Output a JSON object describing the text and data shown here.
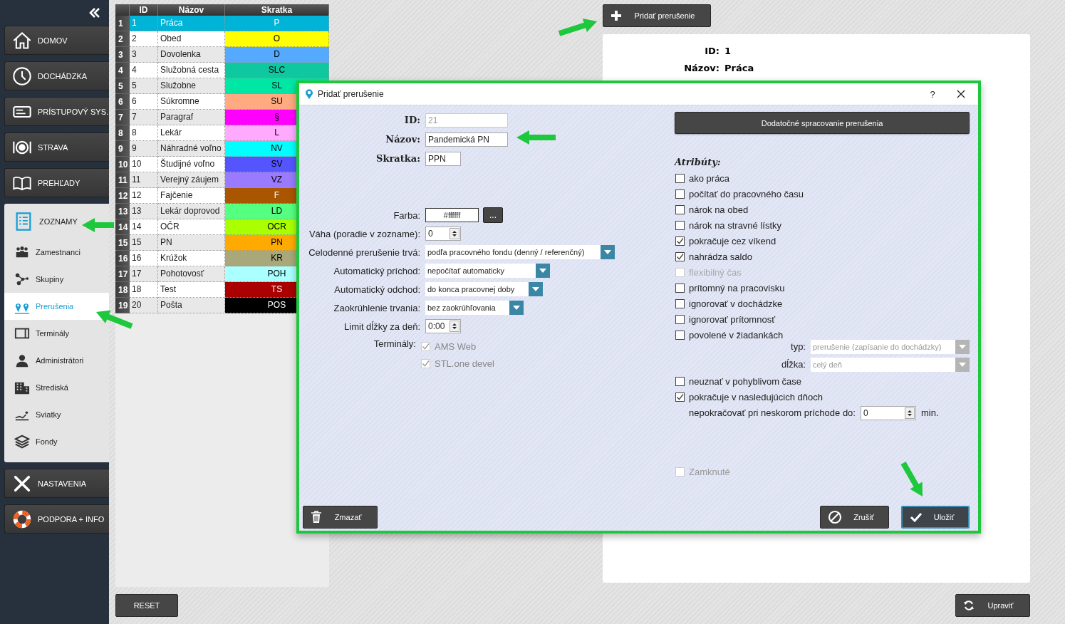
{
  "sidebar": {
    "items": [
      {
        "label": "DOMOV",
        "expanded": false
      },
      {
        "label": "DOCHÁDZKA",
        "expanded": false
      },
      {
        "label": "PRÍSTUPOVÝ SYS.",
        "expanded": false
      },
      {
        "label": "STRAVA",
        "expanded": false
      },
      {
        "label": "PREHĽADY",
        "expanded": false
      },
      {
        "label": "ZOZNAMY",
        "expanded": true,
        "children": [
          {
            "label": "Zamestnanci",
            "selected": false
          },
          {
            "label": "Skupiny",
            "selected": false
          },
          {
            "label": "Prerušenia",
            "selected": true
          },
          {
            "label": "Terminály",
            "selected": false
          },
          {
            "label": "Administrátori",
            "selected": false
          },
          {
            "label": "Strediská",
            "selected": false
          },
          {
            "label": "Sviatky",
            "selected": false
          },
          {
            "label": "Fondy",
            "selected": false
          }
        ]
      },
      {
        "label": "NASTAVENIA",
        "expanded": false
      },
      {
        "label": "PODPORA + INFO",
        "expanded": false
      }
    ]
  },
  "table": {
    "columns": [
      "ID",
      "Názov",
      "Skratka"
    ],
    "rows": [
      {
        "number": "1",
        "id": "1",
        "name": "Práca",
        "code": "P",
        "color": "#00b4d8",
        "selected": true
      },
      {
        "number": "2",
        "id": "2",
        "name": "Obed",
        "code": "O",
        "color": "#ffff00",
        "selected": false
      },
      {
        "number": "3",
        "id": "3",
        "name": "Dovolenka",
        "code": "D",
        "color": "#55aaff",
        "selected": false
      },
      {
        "number": "4",
        "id": "4",
        "name": "Služobná cesta",
        "code": "SLC",
        "color": "#10c8a0",
        "selected": false
      },
      {
        "number": "5",
        "id": "5",
        "name": "Služobne",
        "code": "SL",
        "color": "#00e6a5",
        "selected": false
      },
      {
        "number": "6",
        "id": "6",
        "name": "Súkromne",
        "code": "SU",
        "color": "#ffaa80",
        "selected": false
      },
      {
        "number": "7",
        "id": "7",
        "name": "Paragraf",
        "code": "§",
        "color": "#ff00ff",
        "selected": false
      },
      {
        "number": "8",
        "id": "8",
        "name": "Lekár",
        "code": "L",
        "color": "#ffaaff",
        "selected": false
      },
      {
        "number": "9",
        "id": "9",
        "name": "Náhradné voľno",
        "code": "NV",
        "color": "#00ffff",
        "selected": false
      },
      {
        "number": "10",
        "id": "10",
        "name": "Študijné voľno",
        "code": "SV",
        "color": "#5555ff",
        "selected": false
      },
      {
        "number": "11",
        "id": "11",
        "name": "Verejný záujem",
        "code": "VZ",
        "color": "#9a7aff",
        "selected": false
      },
      {
        "number": "12",
        "id": "12",
        "name": "Fajčenie",
        "code": "F",
        "color": "#aa5500",
        "selected": false
      },
      {
        "number": "13",
        "id": "13",
        "name": "Lekár doprovod",
        "code": "LD",
        "color": "#55ff80",
        "selected": false
      },
      {
        "number": "14",
        "id": "14",
        "name": "OČR",
        "code": "OCR",
        "color": "#aaff00",
        "selected": false
      },
      {
        "number": "15",
        "id": "15",
        "name": "PN",
        "code": "PN",
        "color": "#ffaa00",
        "selected": false
      },
      {
        "number": "16",
        "id": "16",
        "name": "Krúžok",
        "code": "KR",
        "color": "#a8a87a",
        "selected": false
      },
      {
        "number": "17",
        "id": "17",
        "name": "Pohotovosť",
        "code": "POH",
        "color": "#aaffff",
        "selected": false
      },
      {
        "number": "18",
        "id": "18",
        "name": "Test",
        "code": "TS",
        "color": "#aa0000",
        "selected": false
      },
      {
        "number": "19",
        "id": "20",
        "name": "Pošta",
        "code": "POS",
        "color": "#000000",
        "selected": false
      }
    ]
  },
  "reset_button": "RESET",
  "add_button": "Pridať prerušenie",
  "detail": {
    "fields": [
      {
        "label": "ID:",
        "value": "1"
      },
      {
        "label": "Názov:",
        "value": "Práca"
      }
    ]
  },
  "edit_button": "Upraviť",
  "dialog": {
    "title": "Pridať prerušenie",
    "help": "?",
    "fields": [
      {
        "kind": "text",
        "label": "ID:",
        "value": "21",
        "disabled": true
      },
      {
        "kind": "text",
        "label": "Názov:",
        "value": "Pandemická PN",
        "disabled": false
      },
      {
        "kind": "text",
        "label": "Skratka:",
        "value": "PPN",
        "disabled": false
      },
      {
        "kind": "color",
        "label": "Farba:",
        "value": "#ffffff",
        "button": "..."
      },
      {
        "kind": "spin",
        "label": "Váha (poradie v zozname):",
        "value": "0"
      },
      {
        "kind": "select",
        "label": "Celodenné prerušenie trvá:",
        "value": "podľa pracovného fondu (denný / referenčný)"
      },
      {
        "kind": "select",
        "label": "Automatický príchod:",
        "value": "nepočítať automaticky"
      },
      {
        "kind": "select",
        "label": "Automatický odchod:",
        "value": "do konca pracovnej doby"
      },
      {
        "kind": "select",
        "label": "Zaokrúhlenie trvania:",
        "value": "bez zaokrúhľovania"
      },
      {
        "kind": "spin",
        "label": "Limit dĺžky za deň:",
        "value": "0:00"
      },
      {
        "kind": "checks",
        "label": "Terminály:",
        "options": [
          {
            "label": "AMS Web",
            "checked": true,
            "disabled": true
          },
          {
            "label": "STL.one devel",
            "checked": true,
            "disabled": true
          }
        ]
      }
    ],
    "extra_button": "Dodatočné spracovanie prerušenia",
    "attributes_title": "Atribúty:",
    "attributes": [
      {
        "kind": "check",
        "label": "ako práca",
        "checked": false,
        "disabled": false
      },
      {
        "kind": "check",
        "label": "počítať do pracovného času",
        "checked": false,
        "disabled": false
      },
      {
        "kind": "check",
        "label": "nárok na obed",
        "checked": false,
        "disabled": false
      },
      {
        "kind": "check",
        "label": "nárok na stravné lístky",
        "checked": false,
        "disabled": false
      },
      {
        "kind": "check",
        "label": "pokračuje cez víkend",
        "checked": true,
        "disabled": false
      },
      {
        "kind": "check",
        "label": "nahrádza saldo",
        "checked": true,
        "disabled": false
      },
      {
        "kind": "check",
        "label": "flexibilný čas",
        "checked": false,
        "disabled": true
      },
      {
        "kind": "check",
        "label": "prítomný na pracovisku",
        "checked": false,
        "disabled": false
      },
      {
        "kind": "check",
        "label": "ignorovať v dochádzke",
        "checked": false,
        "disabled": false
      },
      {
        "kind": "check",
        "label": "ignorovať prítomnosť",
        "checked": false,
        "disabled": false
      },
      {
        "kind": "check",
        "label": "povolené v žiadankách",
        "checked": false,
        "disabled": false
      },
      {
        "kind": "select",
        "label": "typ:",
        "value": "prerušenie (zapísanie do dochádzky)",
        "disabled": true
      },
      {
        "kind": "select",
        "label": "dĺžka:",
        "value": "celý deň",
        "disabled": true
      },
      {
        "kind": "check",
        "label": "neuznať v pohyblivom čase",
        "checked": false,
        "disabled": false
      },
      {
        "kind": "check",
        "label": "pokračuje v nasledujúcich dňoch",
        "checked": true,
        "disabled": false
      },
      {
        "kind": "spin",
        "label": "nepokračovať pri neskorom príchode do:",
        "value": "0",
        "unit": "min."
      }
    ],
    "locked": {
      "label": "Zamknuté",
      "checked": false,
      "disabled": true
    },
    "buttons": [
      {
        "kind": "delete",
        "label": "Zmazať",
        "selected": false
      },
      {
        "kind": "cancel",
        "label": "Zrušiť",
        "selected": false
      },
      {
        "kind": "save",
        "label": "Uložiť",
        "selected": true
      }
    ]
  }
}
